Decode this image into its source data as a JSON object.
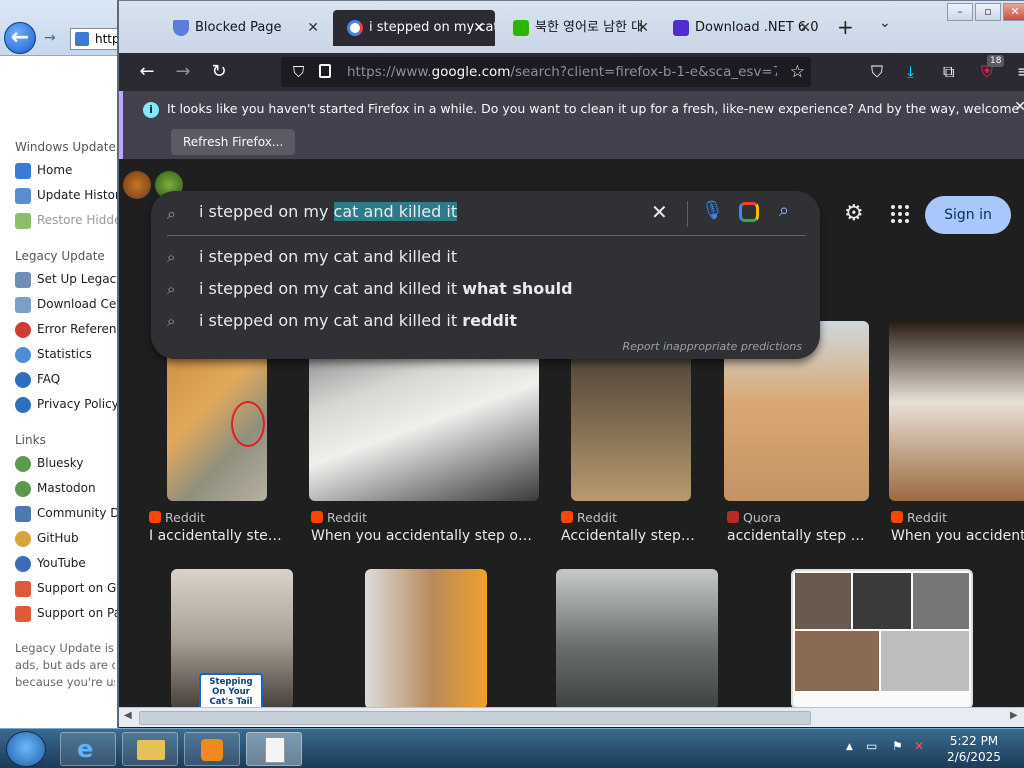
{
  "ie": {
    "address": "http",
    "sidebar": {
      "section1": "Windows Update",
      "items1": [
        {
          "label": "Home",
          "dim": false
        },
        {
          "label": "Update History",
          "dim": false
        },
        {
          "label": "Restore Hidden",
          "dim": true
        }
      ],
      "section2": "Legacy Update",
      "items2": [
        {
          "label": "Set Up Legacy"
        },
        {
          "label": "Download Cen"
        },
        {
          "label": "Error Reference"
        },
        {
          "label": "Statistics"
        },
        {
          "label": "FAQ"
        },
        {
          "label": "Privacy Policy"
        }
      ],
      "section3": "Links",
      "items3": [
        {
          "label": "Bluesky"
        },
        {
          "label": "Mastodon"
        },
        {
          "label": "Community Dis"
        },
        {
          "label": "GitHub"
        },
        {
          "label": "YouTube"
        },
        {
          "label": "Support on Git"
        },
        {
          "label": "Support on Pat"
        }
      ],
      "footer": [
        "Legacy Update is su",
        "ads, but ads are dis",
        "because you're usi"
      ]
    }
  },
  "firefox": {
    "tabs": [
      {
        "label": "Blocked Page",
        "active": false
      },
      {
        "label": "i stepped on my cat",
        "active": true
      },
      {
        "label": "북한 영어로 남한 대",
        "active": false
      },
      {
        "label": "Download .NET 6.0 (",
        "active": false
      }
    ],
    "url_prefix": "https://www.",
    "url_host": "google.com",
    "url_rest": "/search?client=firefox-b-1-e&sca_esv=752bc3",
    "downloads_badge": "18",
    "notification": {
      "message": "It looks like you haven't started Firefox in a while. Do you want to clean it up for a fresh, like-new experience? And by the way, welcome back!",
      "button": "Refresh Firefox..."
    }
  },
  "google": {
    "query_plain": "i stepped on my ",
    "query_selected": "cat and killed it",
    "suggestions": [
      {
        "base": "i stepped on my cat and killed it",
        "bold": ""
      },
      {
        "base": "i stepped on my cat and killed it ",
        "bold": "what should"
      },
      {
        "base": "i stepped on my cat and killed it ",
        "bold": "reddit"
      }
    ],
    "report": "Report inappropriate predictions",
    "signin": "Sign in",
    "results_row1": [
      {
        "source": "Reddit",
        "title": "I accidentally step...",
        "color": "#ff4500"
      },
      {
        "source": "Reddit",
        "title": "When you accidentally step on ...",
        "color": "#ff4500"
      },
      {
        "source": "Reddit",
        "title": "Accidentally stepp...",
        "color": "#ff4500"
      },
      {
        "source": "Quora",
        "title": "accidentally step o...",
        "color": "#b92b27"
      },
      {
        "source": "Reddit",
        "title": "When you accidenta",
        "color": "#ff4500"
      }
    ],
    "sticker": "Stepping On Your Cat's Tail"
  },
  "taskbar": {
    "time": "5:22 PM",
    "date": "2/6/2025"
  }
}
